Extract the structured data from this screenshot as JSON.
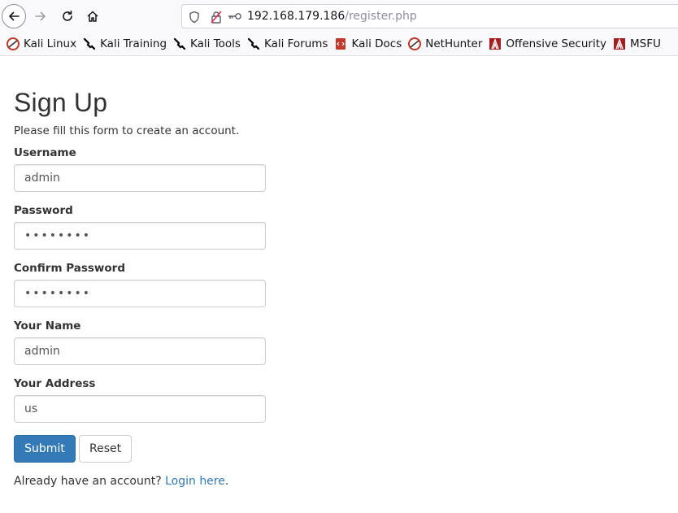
{
  "browser": {
    "url_host": "192.168.179.186",
    "url_path": "/register.php",
    "bookmarks": [
      {
        "label": "Kali Linux",
        "icon": "kali-linux-icon",
        "color": "#c0392b"
      },
      {
        "label": "Kali Training",
        "icon": "kali-dragon-icon",
        "color": "#000000"
      },
      {
        "label": "Kali Tools",
        "icon": "kali-dragon-icon",
        "color": "#000000"
      },
      {
        "label": "Kali Forums",
        "icon": "kali-dragon-icon",
        "color": "#000000"
      },
      {
        "label": "Kali Docs",
        "icon": "kali-docs-icon",
        "color": "#c0392b"
      },
      {
        "label": "NetHunter",
        "icon": "nethunter-icon",
        "color": "#c0392b"
      },
      {
        "label": "Offensive Security",
        "icon": "offsec-icon",
        "color": "#a31f1f"
      },
      {
        "label": "MSFU",
        "icon": "offsec-icon",
        "color": "#a31f1f"
      }
    ]
  },
  "form": {
    "title": "Sign Up",
    "subtitle": "Please fill this form to create an account.",
    "fields": {
      "username": {
        "label": "Username",
        "value": "admin"
      },
      "password": {
        "label": "Password",
        "value": "••••••••"
      },
      "confirm_password": {
        "label": "Confirm Password",
        "value": "••••••••"
      },
      "your_name": {
        "label": "Your Name",
        "value": "admin"
      },
      "your_address": {
        "label": "Your Address",
        "value": "us"
      }
    },
    "submit_label": "Submit",
    "reset_label": "Reset",
    "login_prompt": "Already have an account?",
    "login_link": "Login here",
    "login_suffix": "."
  },
  "colors": {
    "primary": "#337ab7",
    "link": "#337ab7"
  }
}
